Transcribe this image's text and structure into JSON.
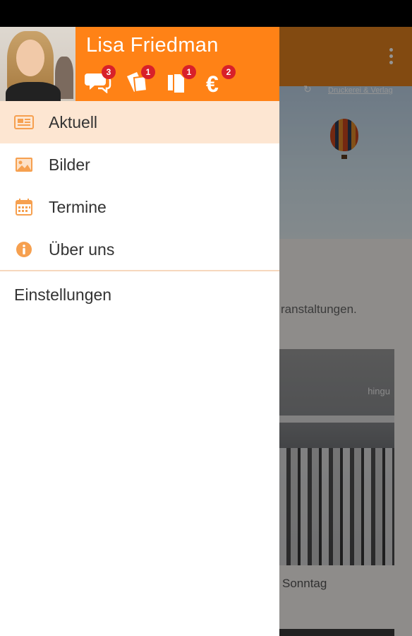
{
  "user": {
    "name": "Lisa Friedman"
  },
  "header_icons": [
    {
      "icon": "chat-bubbles-icon",
      "badge": "3"
    },
    {
      "icon": "tickets-icon",
      "badge": "1"
    },
    {
      "icon": "documents-icon",
      "badge": "1"
    },
    {
      "icon": "euro-icon",
      "badge": "2"
    }
  ],
  "menu": {
    "items": [
      {
        "label": "Aktuell",
        "icon": "newspaper-icon",
        "active": true
      },
      {
        "label": "Bilder",
        "icon": "image-icon",
        "active": false
      },
      {
        "label": "Termine",
        "icon": "calendar-icon",
        "active": false
      },
      {
        "label": "Über uns",
        "icon": "info-icon",
        "active": false
      }
    ],
    "settings_label": "Einstellungen"
  },
  "background": {
    "hero_caption": "Druckerei & Verlag",
    "partial_text": "ranstaltungen.",
    "photo_caption": "Sonntag",
    "shop_sign": "hingu"
  },
  "colors": {
    "accent": "#ff8216",
    "active_item_bg": "#fde6d2",
    "badge": "#d8202a",
    "icon": "#f6a04f"
  }
}
